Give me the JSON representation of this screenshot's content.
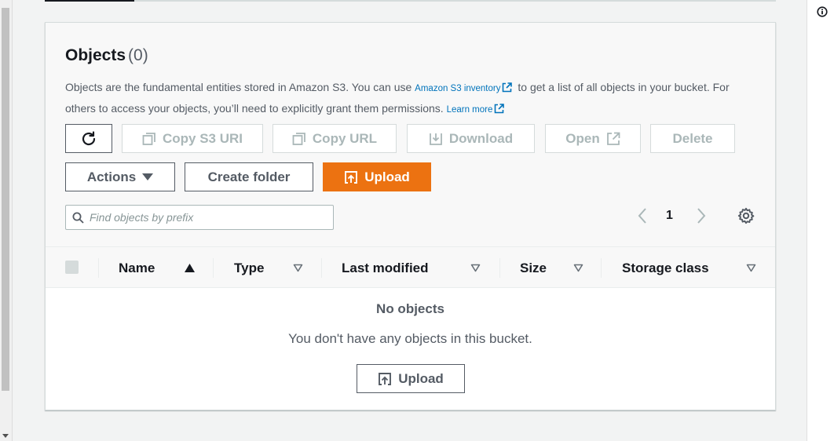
{
  "objects": {
    "title": "Objects",
    "count": "(0)",
    "description_part1": "Objects are the fundamental entities stored in Amazon S3. You can use ",
    "inventory_link": "Amazon S3 inventory",
    "description_part2": " to get a list of all objects in your bucket. For others to access your objects, you’ll need to explicitly grant them permissions. ",
    "learn_more_link": "Learn more"
  },
  "toolbar": {
    "copy_s3_uri": "Copy S3 URI",
    "copy_url": "Copy URL",
    "download": "Download",
    "open": "Open",
    "delete": "Delete",
    "actions": "Actions",
    "create_folder": "Create folder",
    "upload": "Upload"
  },
  "search": {
    "placeholder": "Find objects by prefix",
    "value": ""
  },
  "pagination": {
    "current_page": "1"
  },
  "table": {
    "columns": [
      "Name",
      "Type",
      "Last modified",
      "Size",
      "Storage class"
    ],
    "empty_title": "No objects",
    "empty_description": "You don't have any objects in this bucket.",
    "empty_upload_button": "Upload"
  },
  "colors": {
    "primary": "#ec7211",
    "link": "#0073bb",
    "text": "#16191f",
    "muted": "#545b64",
    "disabled": "#aab7b8"
  }
}
